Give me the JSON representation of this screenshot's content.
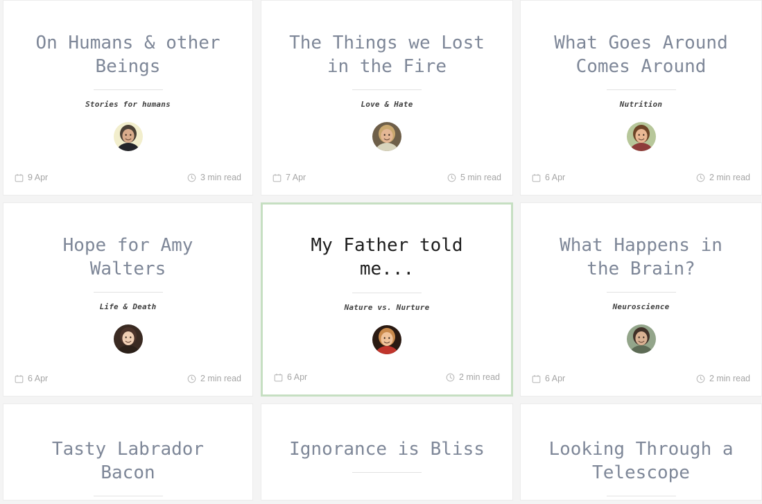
{
  "page": {
    "background_color": "#f4f4f4",
    "card_background": "#ffffff",
    "card_border_color": "#ececec",
    "title_color": "#7e8798",
    "selected_title_color": "#1d1d1d",
    "selected_border_color": "#c6dfc2",
    "meta_color": "#a5a5a5",
    "divider_color": "#e2e2e2"
  },
  "icons": {
    "calendar": "calendar-icon",
    "clock": "clock-icon"
  },
  "cards": [
    {
      "title": "On Humans & other\nBeings",
      "subtitle": "Stories for humans",
      "date": "9 Apr",
      "read_time": "3 min read",
      "selected": false,
      "avatar": {
        "name": "avatar-bald-man",
        "bg": "#f2eecd",
        "skin": "#d8ab8c",
        "hair": "#4a4036",
        "shirt": "#23242a"
      }
    },
    {
      "title": "The Things we Lost\nin the Fire",
      "subtitle": "Love & Hate",
      "date": "7 Apr",
      "read_time": "5 min read",
      "selected": false,
      "avatar": {
        "name": "avatar-smiling-man",
        "bg": "#6e5f49",
        "skin": "#e4b795",
        "hair": "#caa86f",
        "shirt": "#d8d4bd"
      }
    },
    {
      "title": "What Goes Around\nComes Around",
      "subtitle": "Nutrition",
      "date": "6 Apr",
      "read_time": "2 min read",
      "selected": false,
      "avatar": {
        "name": "avatar-woman-green-bg",
        "bg": "#b7c79a",
        "skin": "#eab894",
        "hair": "#6d4427",
        "shirt": "#8e3c3a"
      }
    },
    {
      "title": "Hope for Amy\nWalters",
      "subtitle": "Life & Death",
      "date": "6 Apr",
      "read_time": "2 min read",
      "selected": false,
      "avatar": {
        "name": "avatar-curly-hair-woman",
        "bg": "#3a2a22",
        "skin": "#f0cfb4",
        "hair": "#4b332a",
        "shirt": "#2b2019"
      }
    },
    {
      "title": "My Father told\nme...",
      "subtitle": "Nature vs. Nurture",
      "date": "6 Apr",
      "read_time": "2 min read",
      "selected": true,
      "avatar": {
        "name": "avatar-blonde-woman",
        "bg": "#2a1a12",
        "skin": "#f0c39b",
        "hair": "#c98a4c",
        "shirt": "#c0352c"
      }
    },
    {
      "title": "What Happens in\nthe Brain?",
      "subtitle": "Neuroscience",
      "date": "6 Apr",
      "read_time": "2 min read",
      "selected": false,
      "avatar": {
        "name": "avatar-bearded-man",
        "bg": "#93a58a",
        "skin": "#d9b193",
        "hair": "#403028",
        "shirt": "#5d6b55"
      }
    },
    {
      "title": "Tasty Labrador\nBacon",
      "subtitle": "",
      "date": "",
      "read_time": "",
      "selected": false,
      "avatar": null
    },
    {
      "title": "Ignorance is Bliss",
      "subtitle": "",
      "date": "",
      "read_time": "",
      "selected": false,
      "avatar": null
    },
    {
      "title": "Looking Through a\nTelescope",
      "subtitle": "",
      "date": "",
      "read_time": "",
      "selected": false,
      "avatar": null
    }
  ]
}
